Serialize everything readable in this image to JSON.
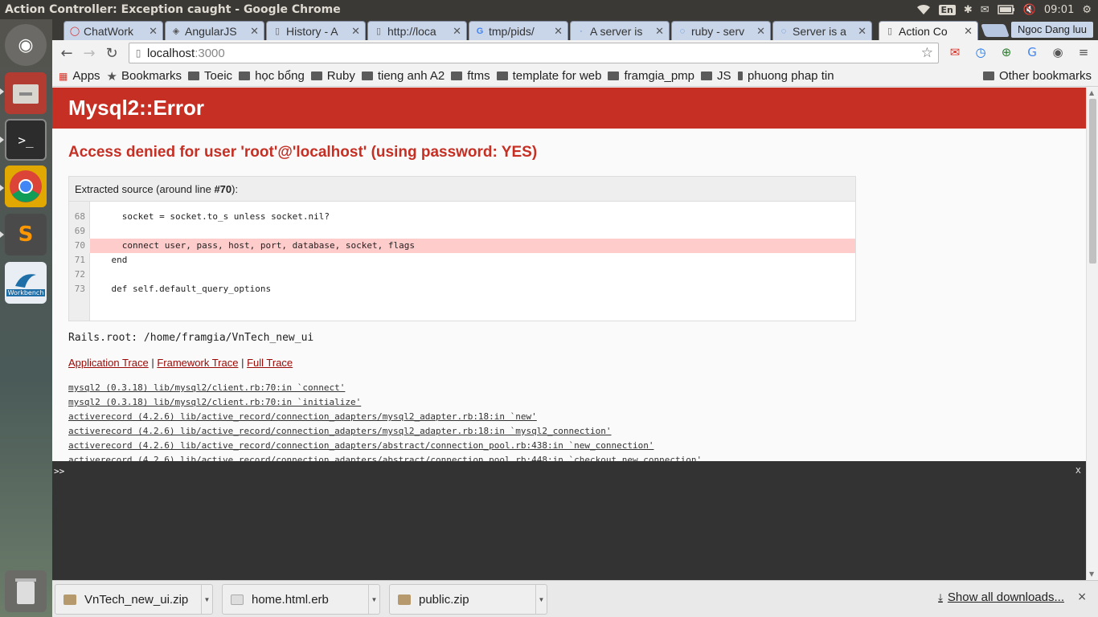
{
  "system": {
    "window_title": "Action Controller: Exception caught - Google Chrome",
    "lang": "En",
    "clock": "09:01"
  },
  "launcher": {
    "items": [
      "ubuntu-home-icon",
      "files-icon",
      "terminal-icon",
      "chrome-icon",
      "sublime-text-icon",
      "mysql-workbench-icon",
      "trash-icon"
    ],
    "workbench_label": "Workbench"
  },
  "tabs": [
    {
      "label": "ChatWork",
      "icon": "chatwork-icon"
    },
    {
      "label": "AngularJS",
      "icon": "angular-icon"
    },
    {
      "label": "History - A",
      "icon": "page-icon"
    },
    {
      "label": "http://loca",
      "icon": "page-icon"
    },
    {
      "label": "tmp/pids/",
      "icon": "google-icon"
    },
    {
      "label": "A server is",
      "icon": "loading-icon"
    },
    {
      "label": "ruby - serv",
      "icon": "loading-icon"
    },
    {
      "label": "Server is a",
      "icon": "loading-icon"
    },
    {
      "label": "Action Co",
      "icon": "page-icon",
      "active": true
    }
  ],
  "profile_name": "Ngoc Dang luu",
  "address": {
    "host": "localhost",
    "port": ":3000"
  },
  "bookmarks": {
    "items": [
      "Apps",
      "Bookmarks",
      "Toeic",
      "học bổng",
      "Ruby",
      "tieng anh A2",
      "ftms",
      "template for web",
      "framgia_pmp",
      "JS",
      "phuong phap tin"
    ],
    "other": "Other bookmarks"
  },
  "page": {
    "error_class": "Mysql2::Error",
    "error_message": "Access denied for user 'root'@'localhost' (using password: YES)",
    "source_heading_prefix": "Extracted source (around line ",
    "source_heading_line": "#70",
    "source_heading_suffix": "):",
    "source_lines": [
      {
        "num": "68",
        "code": "      socket = socket.to_s unless socket.nil?",
        "highlight": false
      },
      {
        "num": "69",
        "code": "",
        "highlight": false
      },
      {
        "num": "70",
        "code": "      connect user, pass, host, port, database, socket, flags",
        "highlight": true
      },
      {
        "num": "71",
        "code": "    end",
        "highlight": false
      },
      {
        "num": "72",
        "code": "",
        "highlight": false
      },
      {
        "num": "73",
        "code": "    def self.default_query_options",
        "highlight": false
      }
    ],
    "rails_root": "Rails.root: /home/framgia/VnTech_new_ui",
    "trace_links": {
      "application": "Application Trace",
      "framework": "Framework Trace",
      "full": "Full Trace",
      "sep": " | "
    },
    "trace": [
      "mysql2 (0.3.18) lib/mysql2/client.rb:70:in `connect'",
      "mysql2 (0.3.18) lib/mysql2/client.rb:70:in `initialize'",
      "activerecord (4.2.6) lib/active_record/connection_adapters/mysql2_adapter.rb:18:in `new'",
      "activerecord (4.2.6) lib/active_record/connection_adapters/mysql2_adapter.rb:18:in `mysql2_connection'",
      "activerecord (4.2.6) lib/active_record/connection_adapters/abstract/connection_pool.rb:438:in `new_connection'",
      "activerecord (4.2.6) lib/active_record/connection_adapters/abstract/connection_pool.rb:448:in `checkout_new_connection'"
    ]
  },
  "console": {
    "prompt": ">>",
    "close": "x"
  },
  "downloads": {
    "items": [
      {
        "name": "VnTech_new_ui.zip",
        "icon": "archive-icon"
      },
      {
        "name": "home.html.erb",
        "icon": "document-icon"
      },
      {
        "name": "public.zip",
        "icon": "archive-icon"
      }
    ],
    "show_all": "Show all downloads...",
    "close": "×"
  }
}
